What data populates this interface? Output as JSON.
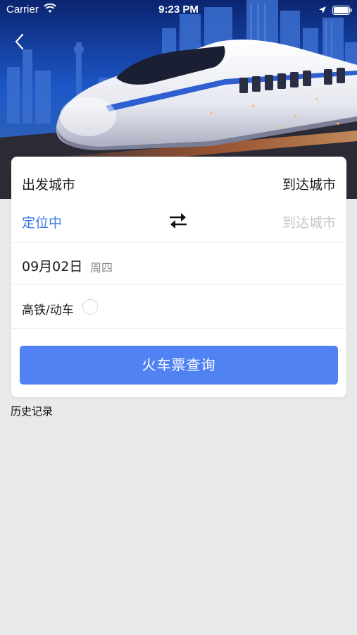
{
  "status_bar": {
    "carrier": "Carrier",
    "time": "9:23 PM",
    "icons": [
      "wifi-icon",
      "location-arrow-icon",
      "battery-icon"
    ]
  },
  "nav": {
    "back_icon": "chevron-left-icon"
  },
  "banner": {
    "subject": "high-speed train"
  },
  "form": {
    "from_label": "出发城市",
    "to_label": "到达城市",
    "from_value": "定位中",
    "to_placeholder": "到达城市",
    "swap_icon": "swap-arrows-icon",
    "date": "09月02日",
    "weekday": "周四",
    "high_speed_label": "高铁/动车",
    "high_speed_checked": false,
    "search_button": "火车票查询"
  },
  "history": {
    "title": "历史记录"
  },
  "colors": {
    "accent": "#5082f3",
    "location_text": "#3a7be9",
    "placeholder": "#c4c4c4",
    "background": "#e9e9e9"
  }
}
